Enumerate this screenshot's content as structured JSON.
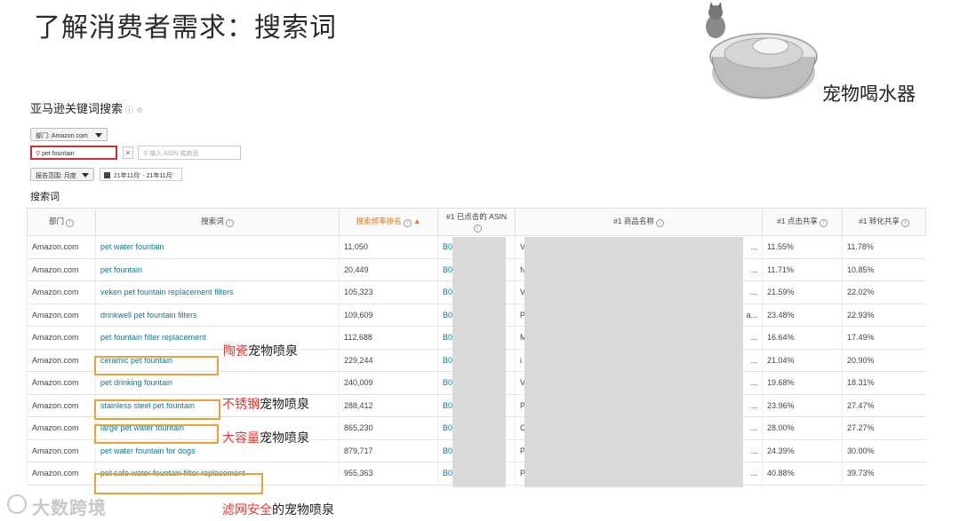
{
  "slide": {
    "title": "了解消费者需求：搜索词"
  },
  "product": {
    "label": "宠物喝水器"
  },
  "tool": {
    "title": "亚马逊关键词搜索",
    "dept_select": "部门: Amazon.com",
    "search_value": "pet fountain",
    "clear": "×",
    "asin_placeholder": "输入 ASIN 或商品",
    "range_select": "报告范围: 月度",
    "date_range": "21年11月' - 21年11月'",
    "section_label": "搜索词"
  },
  "table": {
    "headers": [
      "部门",
      "搜索词",
      "搜索频率排名",
      "#1 已点击的 ASIN",
      "#1 商品名称",
      "#1 点击共享",
      "#1 转化共享"
    ],
    "rows": [
      {
        "dept": "Amazon.com",
        "term": "pet water fountain",
        "rank": "11,050",
        "asin": "B0",
        "name": "V",
        "name_end": "...",
        "click": "11.55%",
        "conv": "11.78%"
      },
      {
        "dept": "Amazon.com",
        "term": "pet fountain",
        "rank": "20,449",
        "asin": "B0",
        "name": "N",
        "name_end": "...",
        "click": "11.71%",
        "conv": "10.85%"
      },
      {
        "dept": "Amazon.com",
        "term": "veken pet fountain replacement filters",
        "rank": "105,323",
        "asin": "B0",
        "name": "V",
        "name_end": "...",
        "click": "21.59%",
        "conv": "22.02%"
      },
      {
        "dept": "Amazon.com",
        "term": "drinkwell pet fountain filters",
        "rank": "109,609",
        "asin": "B0",
        "name": "P",
        "name_end": "a...",
        "click": "23.48%",
        "conv": "22.93%"
      },
      {
        "dept": "Amazon.com",
        "term": "pet fountain filter replacement",
        "rank": "112,688",
        "asin": "B0",
        "name": "M",
        "name_end": "...",
        "click": "16.64%",
        "conv": "17.49%"
      },
      {
        "dept": "Amazon.com",
        "term": "ceramic pet fountain",
        "rank": "229,244",
        "asin": "B0",
        "name": "i",
        "name_end": "...",
        "click": "21.04%",
        "conv": "20.90%"
      },
      {
        "dept": "Amazon.com",
        "term": "pet drinking fountain",
        "rank": "240,009",
        "asin": "B0",
        "name": "V",
        "name_end": "...",
        "click": "19.68%",
        "conv": "18.31%"
      },
      {
        "dept": "Amazon.com",
        "term": "stainless steel pet fountain",
        "rank": "288,412",
        "asin": "B0",
        "name": "P",
        "name_end": "...",
        "click": "23.96%",
        "conv": "27.47%"
      },
      {
        "dept": "Amazon.com",
        "term": "large pet water fountain",
        "rank": "865,230",
        "asin": "B0",
        "name": "C",
        "name_end": "...",
        "click": "28.00%",
        "conv": "27.27%"
      },
      {
        "dept": "Amazon.com",
        "term": "pet water fountain for dogs",
        "rank": "879,717",
        "asin": "B0",
        "name": "P",
        "name_end": "...",
        "click": "24.39%",
        "conv": "30.00%"
      },
      {
        "dept": "Amazon.com",
        "term": "pet safe water fountain filter replacement",
        "rank": "955,363",
        "asin": "B0",
        "name": "P",
        "name_end": "...",
        "click": "40.88%",
        "conv": "39.73%"
      }
    ]
  },
  "annotations": {
    "ceramic_red": "陶瓷",
    "ceramic_black": "宠物喷泉",
    "steel_red": "不锈钢",
    "steel_black": "宠物喷泉",
    "large_red": "大容量",
    "large_black": "宠物喷泉",
    "filter_red": "滤网安全",
    "filter_black": "的宠物喷泉"
  },
  "watermark": "大数跨境"
}
